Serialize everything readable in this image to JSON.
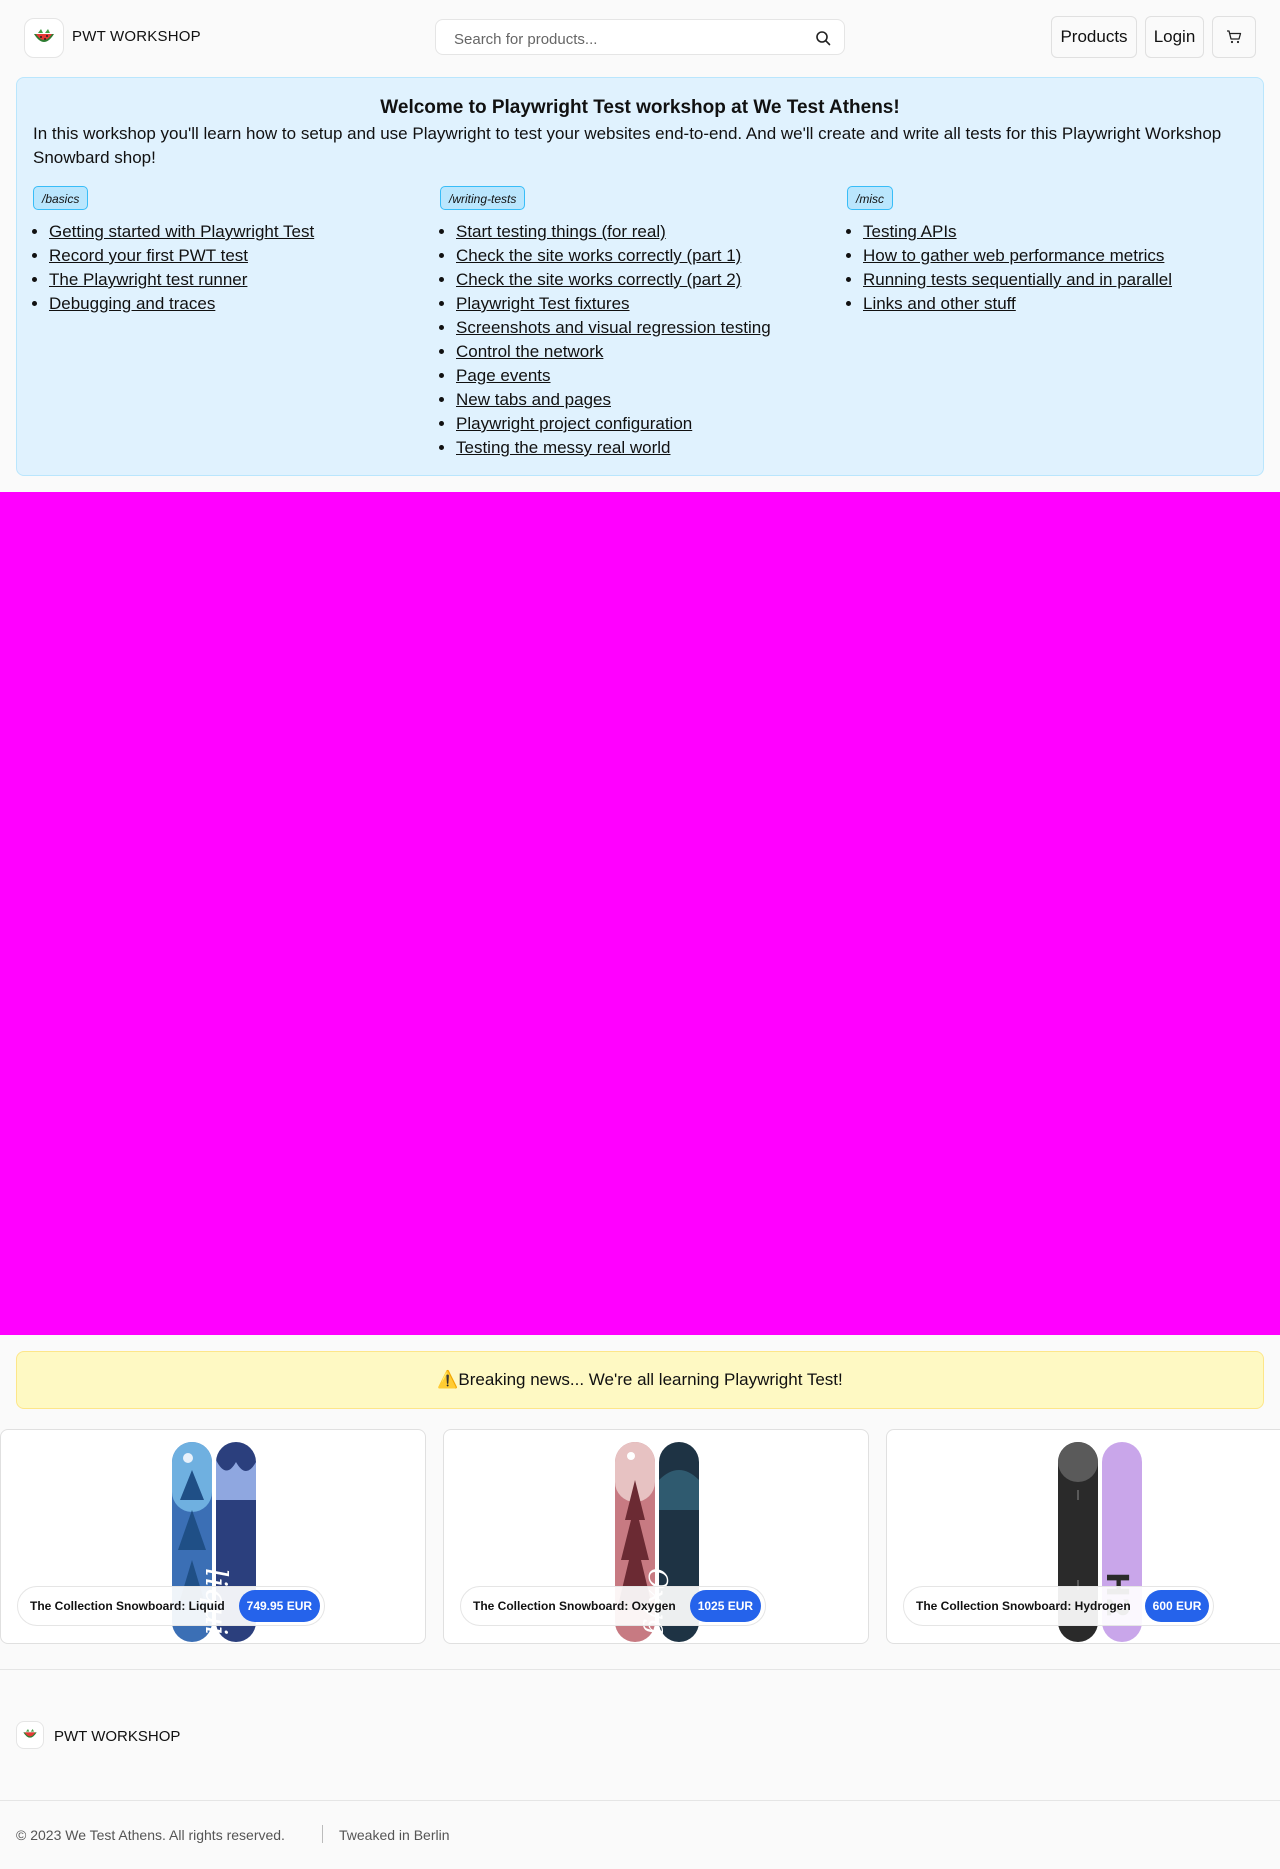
{
  "header": {
    "brand": "PWT WORKSHOP",
    "logo_icon": "watermelon-logo-icon",
    "search_placeholder": "Search for products...",
    "search_icon": "search-icon",
    "nav": {
      "products": "Products",
      "login": "Login"
    },
    "cart_icon": "cart-icon"
  },
  "welcome": {
    "title": "Welcome to Playwright Test workshop at We Test Athens!",
    "intro": "In this workshop you'll learn how to setup and use Playwright to test your websites end-to-end. And we'll create and write all tests for this Playwright Workshop Snowbard shop!",
    "columns": [
      {
        "tag": "/basics",
        "links": [
          "Getting started with Playwright Test",
          "Record your first PWT test",
          "The Playwright test runner",
          "Debugging and traces"
        ]
      },
      {
        "tag": "/writing-tests",
        "links": [
          "Start testing things (for real)",
          "Check the site works correctly (part 1)",
          "Check the site works correctly (part 2)",
          "Playwright Test fixtures",
          "Screenshots and visual regression testing",
          "Control the network",
          "Page events",
          "New tabs and pages",
          "Playwright project configuration",
          "Testing the messy real world"
        ]
      },
      {
        "tag": "/misc",
        "links": [
          "Testing APIs",
          "How to gather web performance metrics",
          "Running tests sequentially and in parallel",
          "Links and other stuff"
        ]
      }
    ]
  },
  "hero": {
    "color": "#ff00ff"
  },
  "news": {
    "icon": "⚠️",
    "text": "Breaking news... We're all learning Playwright Test!"
  },
  "products": [
    {
      "name": "The Collection Snowboard: Liquid",
      "price": "749.95 EUR"
    },
    {
      "name": "The Collection Snowboard: Oxygen",
      "price": "1025 EUR"
    },
    {
      "name": "The Collection Snowboard: Hydrogen",
      "price": "600 EUR"
    }
  ],
  "footer": {
    "brand": "PWT WORKSHOP",
    "copyright": "© 2023 We Test Athens. All rights reserved.",
    "tweaked": "Tweaked in Berlin"
  },
  "colors": {
    "accent": "#2563eb",
    "welcome_bg": "#e0f2fe",
    "news_bg": "#fef9c3"
  }
}
